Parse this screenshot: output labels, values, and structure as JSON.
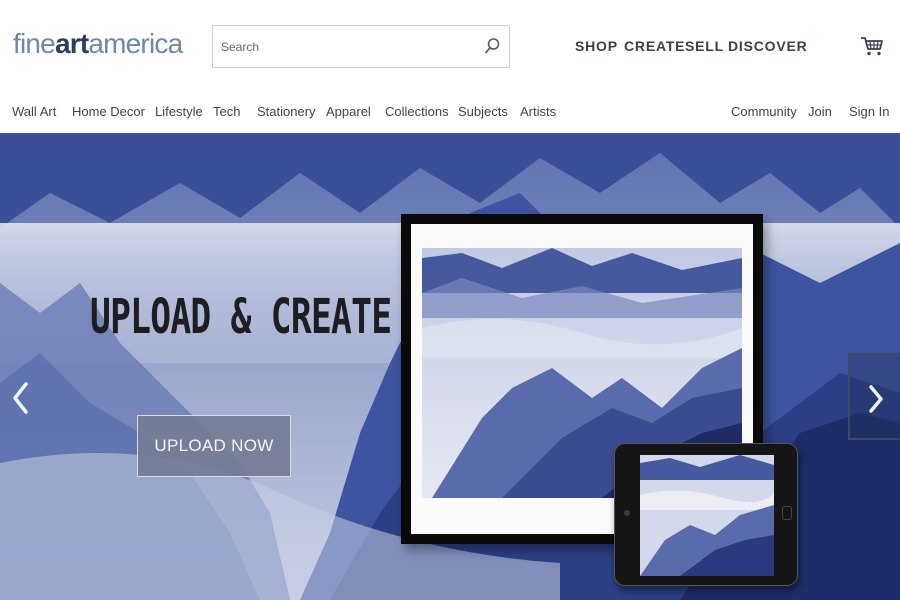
{
  "logo": {
    "part1": "fine",
    "part2": "art",
    "part3": "america"
  },
  "search": {
    "placeholder": "Search"
  },
  "top_nav": [
    "SHOP",
    "CREATE",
    "SELL",
    "DISCOVER"
  ],
  "category_nav": [
    "Wall Art",
    "Home Decor",
    "Lifestyle",
    "Tech",
    "Stationery",
    "Apparel",
    "Collections",
    "Subjects",
    "Artists"
  ],
  "account_nav": [
    "Community",
    "Join",
    "Sign In"
  ],
  "hero": {
    "headline": "UPLOAD & CREATE",
    "button_label": "UPLOAD NOW"
  },
  "icons": {
    "search": "search-icon",
    "cart": "cart-icon",
    "prev": "chevron-left-icon",
    "next": "chevron-right-icon"
  },
  "colors": {
    "logo_light": "#6f87a8",
    "logo_dark": "#2c3e5e",
    "nav_text": "#3a3f4a",
    "hero_blue": "#3d55a0",
    "button_bg": "#757c94"
  }
}
